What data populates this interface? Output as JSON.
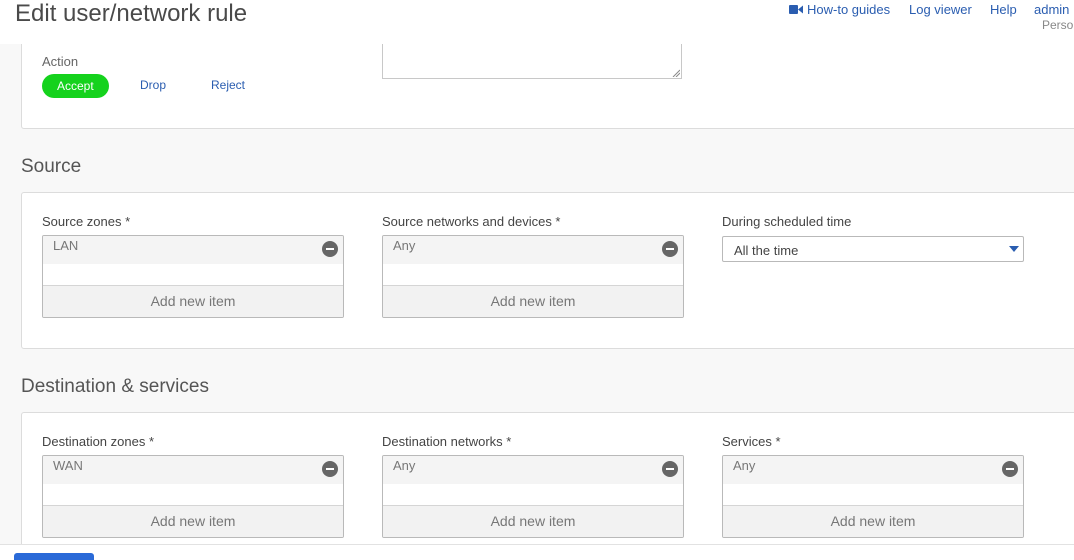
{
  "page": {
    "title": "Edit user/network rule"
  },
  "header": {
    "links": [
      {
        "label": "How-to guides",
        "icon": "video-camera-icon"
      },
      {
        "label": "Log viewer"
      },
      {
        "label": "Help"
      },
      {
        "label": "admin"
      }
    ],
    "persona": "Perso"
  },
  "action": {
    "label": "Action",
    "options": [
      "Accept",
      "Drop",
      "Reject"
    ],
    "selected": "Accept",
    "accent": "#15d21d"
  },
  "source": {
    "title": "Source",
    "zones": {
      "label": "Source zones *",
      "items": [
        "LAN"
      ],
      "add_label": "Add new item"
    },
    "networks": {
      "label": "Source networks and devices *",
      "items": [
        "Any"
      ],
      "add_label": "Add new item"
    },
    "schedule": {
      "label": "During scheduled time",
      "value": "All the time"
    }
  },
  "destination": {
    "title": "Destination & services",
    "zones": {
      "label": "Destination zones *",
      "items": [
        "WAN"
      ],
      "add_label": "Add new item"
    },
    "networks": {
      "label": "Destination networks *",
      "items": [
        "Any"
      ],
      "add_label": "Add new item"
    },
    "services": {
      "label": "Services *",
      "items": [
        "Any"
      ],
      "add_label": "Add new item"
    }
  },
  "colors": {
    "link": "#2a5db0",
    "primary": "#2a6ad8"
  }
}
